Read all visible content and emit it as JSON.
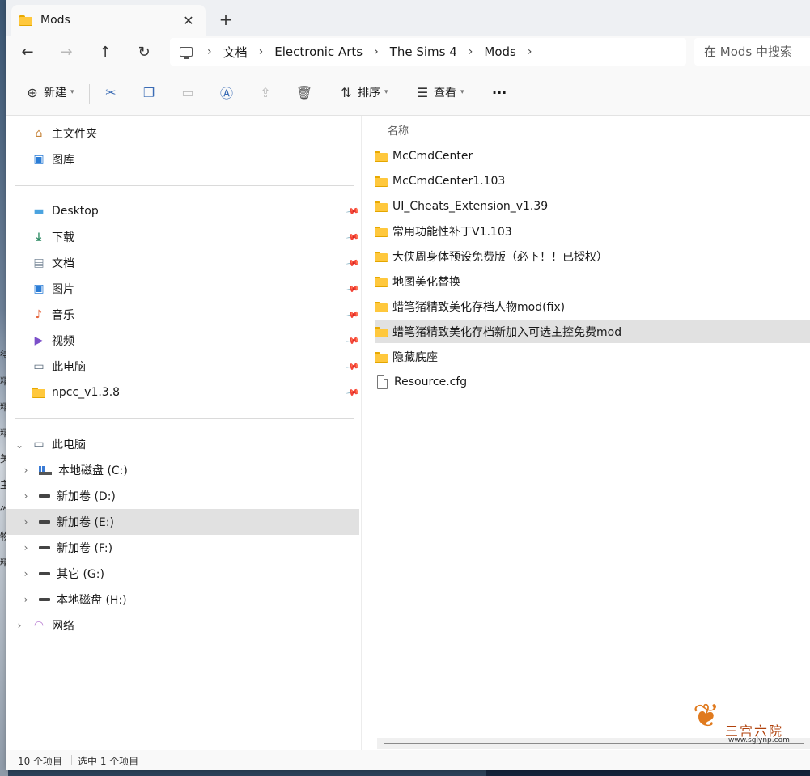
{
  "window": {
    "tab_title": "Mods",
    "tab_close": "✕",
    "new_tab": "+"
  },
  "nav": {
    "back": "←",
    "forward": "→",
    "up": "↑",
    "refresh": "↻",
    "breadcrumb": [
      "文档",
      "Electronic Arts",
      "The Sims 4",
      "Mods"
    ],
    "search_placeholder": "在 Mods 中搜索"
  },
  "toolbar": {
    "new_label": "新建",
    "sort_label": "排序",
    "view_label": "查看",
    "more_label": "···"
  },
  "sidebar": {
    "home": "主文件夹",
    "gallery": "图库",
    "quick_access": [
      {
        "label": "Desktop",
        "icon": "desktop-icon"
      },
      {
        "label": "下载",
        "icon": "download-icon"
      },
      {
        "label": "文档",
        "icon": "document-icon"
      },
      {
        "label": "图片",
        "icon": "pictures-icon"
      },
      {
        "label": "音乐",
        "icon": "music-icon"
      },
      {
        "label": "视频",
        "icon": "video-icon"
      },
      {
        "label": "此电脑",
        "icon": "computer-icon"
      },
      {
        "label": "npcc_v1.3.8",
        "icon": "folder-icon"
      }
    ],
    "this_pc": "此电脑",
    "drives": [
      {
        "label": "本地磁盘 (C:)"
      },
      {
        "label": "新加卷 (D:)"
      },
      {
        "label": "新加卷 (E:)"
      },
      {
        "label": "新加卷 (F:)"
      },
      {
        "label": "其它 (G:)"
      },
      {
        "label": "本地磁盘 (H:)"
      }
    ],
    "network": "网络"
  },
  "filelist": {
    "column_name": "名称",
    "items": [
      {
        "name": "McCmdCenter",
        "type": "folder"
      },
      {
        "name": "McCmdCenter1.103",
        "type": "folder"
      },
      {
        "name": "UI_Cheats_Extension_v1.39",
        "type": "folder"
      },
      {
        "name": "常用功能性补丁V1.103",
        "type": "folder"
      },
      {
        "name": "大侠周身体预设免费版（必下！！已授权）",
        "type": "folder"
      },
      {
        "name": "地图美化替换",
        "type": "folder"
      },
      {
        "name": "蜡笔猪精致美化存档人物mod(fix)",
        "type": "folder"
      },
      {
        "name": "蜡笔猪精致美化存档新加入可选主控免费mod",
        "type": "folder",
        "selected": true
      },
      {
        "name": "隐藏底座",
        "type": "folder"
      },
      {
        "name": "Resource.cfg",
        "type": "file"
      }
    ]
  },
  "status": {
    "item_count": "10 个项目",
    "selected_count": "选中 1 个项目"
  },
  "desktop_strip": [
    "待",
    "精",
    "精",
    "精",
    "美",
    "主",
    "件",
    "物",
    "精"
  ],
  "watermark": {
    "text": "三宫六院",
    "url": "www.sglynp.com"
  },
  "colors": {
    "folder": "#ffc83d",
    "selection": "#e1e1e1",
    "accent": "#3b6cb5"
  }
}
